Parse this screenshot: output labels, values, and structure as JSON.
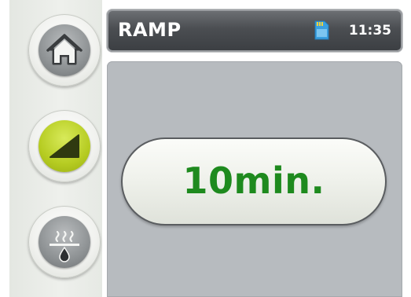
{
  "header": {
    "title": "RAMP",
    "time": "11:35",
    "storage_icon": "sd-card-icon"
  },
  "sidebar": {
    "buttons": [
      {
        "icon": "home-icon",
        "active": false
      },
      {
        "icon": "ramp-icon",
        "active": true
      },
      {
        "icon": "steam-drip-icon",
        "active": false
      }
    ]
  },
  "main": {
    "value": "10min."
  },
  "colors": {
    "value_text": "#1e8a1e",
    "active_button": "#b6cc22",
    "inactive_button": "#8e9294",
    "header_bg": "#4b4e52",
    "panel_bg": "#b7bbbf"
  }
}
